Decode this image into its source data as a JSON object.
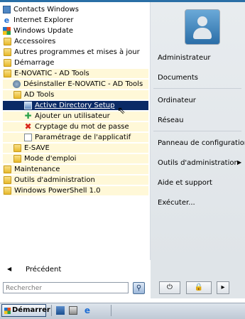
{
  "left_items": [
    {
      "label": "Contacts Windows",
      "icon": "contacts-icon"
    },
    {
      "label": "Internet Explorer",
      "icon": "ie-icon"
    },
    {
      "label": "Windows Update",
      "icon": "windows-update-icon"
    },
    {
      "label": "Accessoires",
      "icon": "folder-icon"
    },
    {
      "label": "Autres programmes et mises à jour",
      "icon": "folder-icon"
    },
    {
      "label": "Démarrage",
      "icon": "folder-icon"
    },
    {
      "label": "E-NOVATIC - AD Tools",
      "icon": "folder-icon"
    },
    {
      "label": "Désinstaller E-NOVATIC - AD Tools",
      "icon": "uninstall-icon"
    },
    {
      "label": "AD Tools",
      "icon": "folder-icon"
    },
    {
      "label": "Active Directory Setup",
      "icon": "app-icon"
    },
    {
      "label": "Ajouter un utilisateur",
      "icon": "add-user-icon"
    },
    {
      "label": "Cryptage du mot de passe",
      "icon": "red-x-icon"
    },
    {
      "label": "Paramétrage de l'applicatif",
      "icon": "document-icon"
    },
    {
      "label": "E-SAVE",
      "icon": "folder-icon"
    },
    {
      "label": "Mode d'emploi",
      "icon": "folder-icon"
    },
    {
      "label": "Maintenance",
      "icon": "folder-icon"
    },
    {
      "label": "Outils d'administration",
      "icon": "folder-icon"
    },
    {
      "label": "Windows PowerShell 1.0",
      "icon": "folder-icon"
    }
  ],
  "back_label": "Précédent",
  "search_placeholder": "Rechercher",
  "right_items": [
    {
      "label": "Administrateur"
    },
    {
      "label": "Documents"
    },
    {
      "label": "Ordinateur"
    },
    {
      "label": "Réseau"
    },
    {
      "label": "Panneau de configuration"
    },
    {
      "label": "Outils d'administration",
      "has_submenu": true
    },
    {
      "label": "Aide et support"
    },
    {
      "label": "Exécuter..."
    }
  ],
  "start_label": "Démarrer",
  "colors": {
    "selection": "#0a2a66",
    "highlight": "#fff8d8",
    "accent": "#2a6fa6"
  }
}
